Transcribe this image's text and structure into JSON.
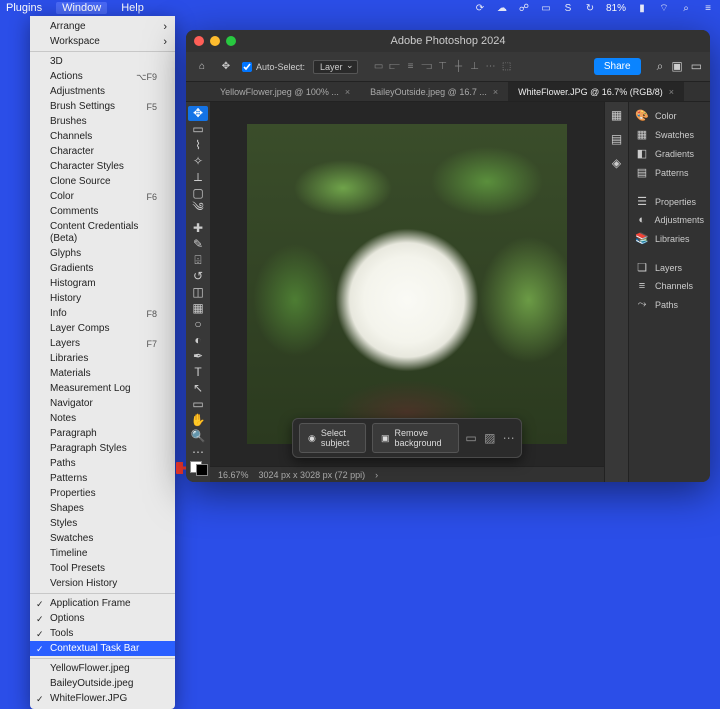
{
  "menubar": {
    "items": [
      "Plugins",
      "Window",
      "Help"
    ],
    "active": "Window",
    "status_right": {
      "battery": "81%"
    }
  },
  "window_menu": {
    "groups": [
      [
        {
          "label": "Arrange",
          "arrow": true
        },
        {
          "label": "Workspace",
          "arrow": true
        }
      ],
      [
        {
          "label": "3D"
        },
        {
          "label": "Actions",
          "shortcut": "⌥F9"
        },
        {
          "label": "Adjustments"
        },
        {
          "label": "Brush Settings",
          "shortcut": "F5"
        },
        {
          "label": "Brushes"
        },
        {
          "label": "Channels"
        },
        {
          "label": "Character"
        },
        {
          "label": "Character Styles"
        },
        {
          "label": "Clone Source"
        },
        {
          "label": "Color",
          "shortcut": "F6"
        },
        {
          "label": "Comments"
        },
        {
          "label": "Content Credentials (Beta)"
        },
        {
          "label": "Glyphs"
        },
        {
          "label": "Gradients"
        },
        {
          "label": "Histogram"
        },
        {
          "label": "History"
        },
        {
          "label": "Info",
          "shortcut": "F8"
        },
        {
          "label": "Layer Comps"
        },
        {
          "label": "Layers",
          "shortcut": "F7"
        },
        {
          "label": "Libraries"
        },
        {
          "label": "Materials"
        },
        {
          "label": "Measurement Log"
        },
        {
          "label": "Navigator"
        },
        {
          "label": "Notes"
        },
        {
          "label": "Paragraph"
        },
        {
          "label": "Paragraph Styles"
        },
        {
          "label": "Paths"
        },
        {
          "label": "Patterns"
        },
        {
          "label": "Properties"
        },
        {
          "label": "Shapes"
        },
        {
          "label": "Styles"
        },
        {
          "label": "Swatches"
        },
        {
          "label": "Timeline"
        },
        {
          "label": "Tool Presets"
        },
        {
          "label": "Version History"
        }
      ],
      [
        {
          "label": "Application Frame",
          "checked": true
        },
        {
          "label": "Options",
          "checked": true
        },
        {
          "label": "Tools",
          "checked": true
        },
        {
          "label": "Contextual Task Bar",
          "checked": true,
          "highlight": true
        }
      ],
      [
        {
          "label": "YellowFlower.jpeg"
        },
        {
          "label": "BaileyOutside.jpeg"
        },
        {
          "label": "WhiteFlower.JPG",
          "checked": true
        }
      ]
    ]
  },
  "ps": {
    "title": "Adobe Photoshop 2024",
    "options": {
      "auto_select_label": "Auto-Select:",
      "auto_select_target": "Layer",
      "share": "Share"
    },
    "tabs": [
      {
        "label": "YellowFlower.jpeg @ 100% ...",
        "active": false
      },
      {
        "label": "BaileyOutside.jpeg @ 16.7 ...",
        "active": false
      },
      {
        "label": "WhiteFlower.JPG @ 16.7% (RGB/8)",
        "active": true
      }
    ],
    "status": {
      "zoom": "16.67%",
      "dims": "3024 px x 3028 px (72 ppi)"
    },
    "ctxbar": {
      "select_subject": "Select subject",
      "remove_bg": "Remove background"
    },
    "panels": [
      [
        {
          "icon": "🎨",
          "label": "Color"
        },
        {
          "icon": "▦",
          "label": "Swatches"
        },
        {
          "icon": "◧",
          "label": "Gradients"
        },
        {
          "icon": "▤",
          "label": "Patterns"
        }
      ],
      [
        {
          "icon": "☰",
          "label": "Properties"
        },
        {
          "icon": "◐",
          "label": "Adjustments"
        },
        {
          "icon": "📚",
          "label": "Libraries"
        }
      ],
      [
        {
          "icon": "❏",
          "label": "Layers"
        },
        {
          "icon": "≡",
          "label": "Channels"
        },
        {
          "icon": "⤳",
          "label": "Paths"
        }
      ]
    ],
    "tools": [
      "move",
      "marquee",
      "lasso",
      "wand",
      "crop",
      "frame",
      "eyedrop",
      "heal",
      "brush",
      "stamp",
      "history",
      "eraser",
      "gradient",
      "blur",
      "dodge",
      "pen",
      "type",
      "path",
      "rect",
      "hand",
      "zoom",
      "edit"
    ]
  }
}
